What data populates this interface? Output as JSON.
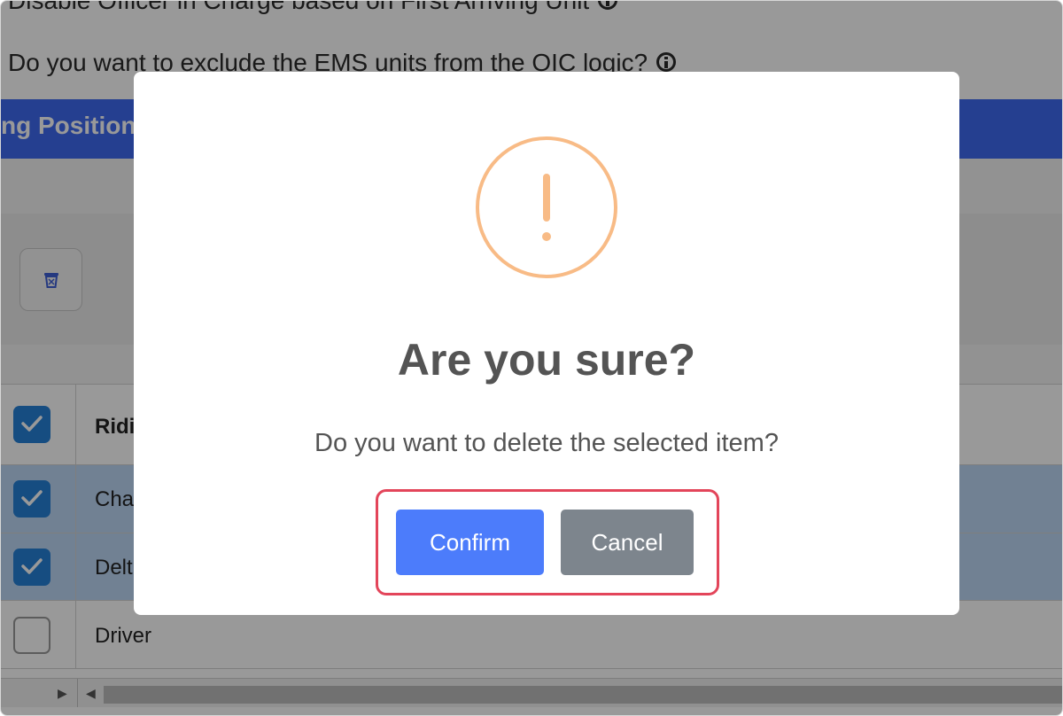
{
  "background": {
    "top_setting_label": "Disable Officer in Charge based on First Arriving Unit",
    "ems_question": "Do you want to exclude the EMS units from the OIC logic?",
    "section_banner": "ng Position",
    "table": {
      "header": "Ridi",
      "rows": [
        {
          "label": "Cha",
          "checked": true
        },
        {
          "label": "Delt",
          "checked": true
        },
        {
          "label": "Driver",
          "checked": false
        }
      ]
    }
  },
  "modal": {
    "icon": "warning-exclamation-icon",
    "title": "Are you sure?",
    "message": "Do you want to delete the selected item?",
    "confirm_label": "Confirm",
    "cancel_label": "Cancel"
  },
  "colors": {
    "banner": "#3f6af0",
    "checkbox_checked": "#2580d8",
    "warning": "#f8bb86",
    "confirm": "#4c7cfb",
    "cancel": "#7d858d",
    "highlight": "#e3455a"
  }
}
